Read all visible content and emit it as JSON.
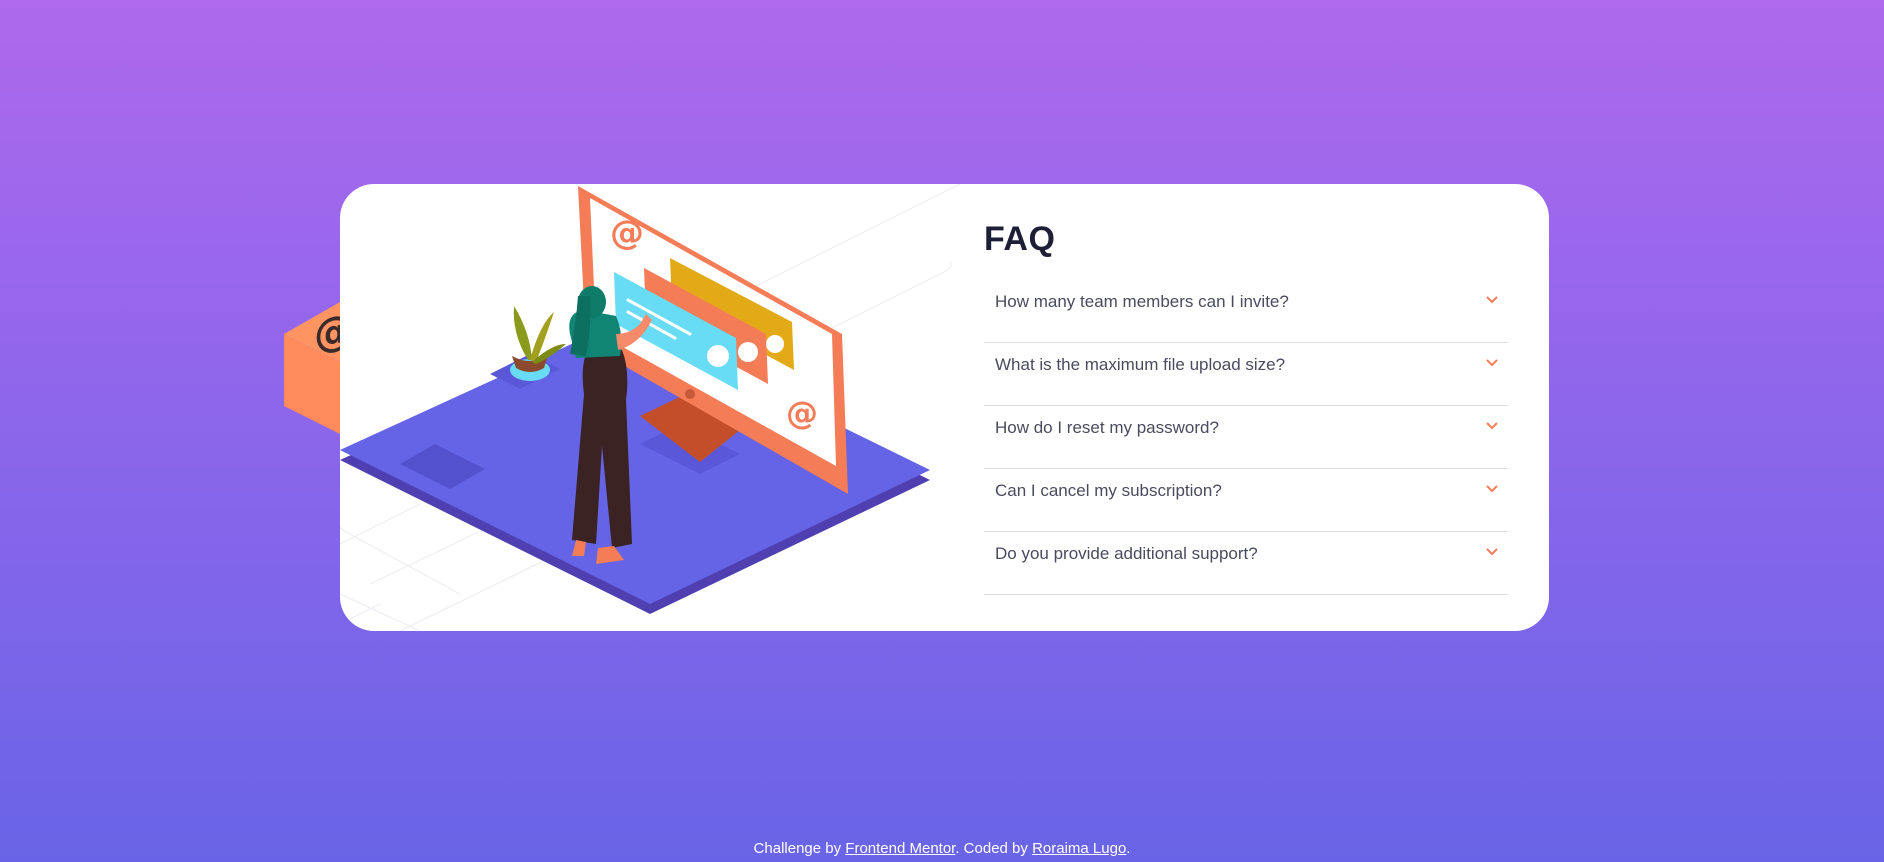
{
  "faq": {
    "title": "FAQ",
    "items": [
      {
        "question": "How many team members can I invite?"
      },
      {
        "question": "What is the maximum file upload size?"
      },
      {
        "question": "How do I reset my password?"
      },
      {
        "question": "Can I cancel my subscription?"
      },
      {
        "question": "Do you provide additional support?"
      }
    ],
    "expand_icon": "chevron-down-icon"
  },
  "footer": {
    "prefix": "Challenge by",
    "link1": "Frontend Mentor",
    "middle": ". Coded by",
    "link2": "Roraima Lugo",
    "suffix": "."
  },
  "colors": {
    "background_top": "#ae69ec",
    "background_bottom": "#6964e7",
    "accent": "#f47c57",
    "title": "#1e1f36",
    "text": "#4a4b5e"
  }
}
